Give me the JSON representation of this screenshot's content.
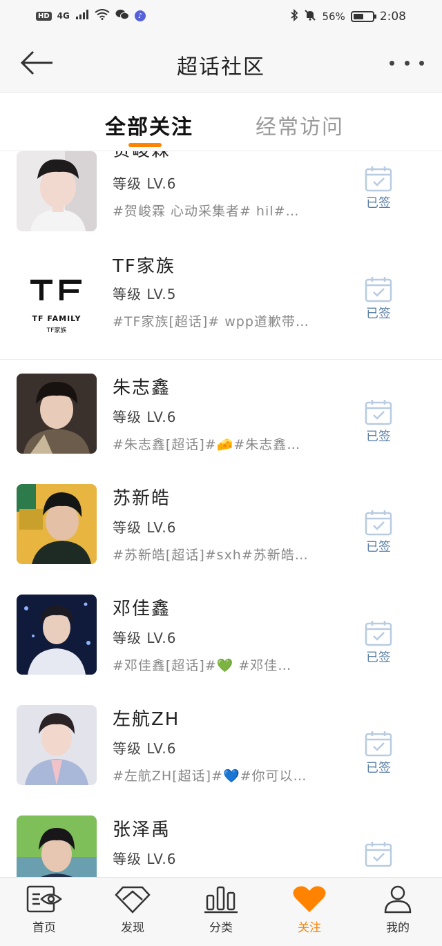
{
  "status_bar": {
    "badge": "HD",
    "network": "4G",
    "battery": "56%",
    "battery_level": 0.56,
    "time": "2:08"
  },
  "header": {
    "title": "超话社区"
  },
  "tabs": [
    {
      "label": "全部关注",
      "active": true
    },
    {
      "label": "经常访问",
      "active": false
    }
  ],
  "list": {
    "items": [
      {
        "name": "贺峻霖",
        "level": "等级 LV.6",
        "desc": "#贺峻霖 心动采集者# hil#…",
        "signed": "已签"
      },
      {
        "name": "TF家族",
        "level": "等级 LV.5",
        "desc": "#TF家族[超话]# wpp道歉带…",
        "signed": "已签",
        "logo": {
          "mark": "TF",
          "line1": "TF FAMILY",
          "line2": "TF家族"
        }
      },
      {
        "name": "朱志鑫",
        "level": "等级 LV.6",
        "desc": "#朱志鑫[超话]#🧀#朱志鑫…",
        "signed": "已签"
      },
      {
        "name": "苏新皓",
        "level": "等级 LV.6",
        "desc": "#苏新皓[超话]#sxh#苏新皓…",
        "signed": "已签"
      },
      {
        "name": "邓佳鑫",
        "level": "等级 LV.6",
        "desc": "#邓佳鑫[超话]#💚 #邓佳…",
        "signed": "已签"
      },
      {
        "name": "左航ZH",
        "level": "等级 LV.6",
        "desc": "#左航ZH[超话]#💙#你可以…",
        "signed": "已签"
      },
      {
        "name": "张泽禹",
        "level": "等级 LV.6",
        "desc": "",
        "signed": ""
      }
    ]
  },
  "bottom_nav": [
    {
      "label": "首页",
      "icon": "home-eye-icon",
      "active": false
    },
    {
      "label": "发现",
      "icon": "diamond-icon",
      "active": false
    },
    {
      "label": "分类",
      "icon": "bars-icon",
      "active": false
    },
    {
      "label": "关注",
      "icon": "heart-icon",
      "active": true
    },
    {
      "label": "我的",
      "icon": "person-icon",
      "active": false
    }
  ],
  "colors": {
    "accent": "#ff8200",
    "signed_blue": "#5b7fa6",
    "background": "#ffffff",
    "bar": "#f7f7f7"
  }
}
